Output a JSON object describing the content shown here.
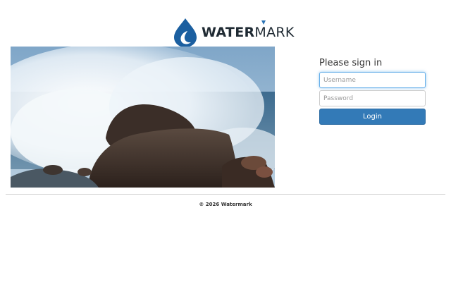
{
  "brand": {
    "name_bold": "WATER",
    "name_light": "MARK",
    "logo_icon": "water-drop-icon",
    "accent": "#2b73b5"
  },
  "hero": {
    "icon": "ocean-wave-rocks-photo"
  },
  "signin": {
    "title": "Please sign in",
    "username_placeholder": "Username",
    "password_placeholder": "Password",
    "login_label": "Login",
    "button_color": "#337ab7"
  },
  "footer": {
    "copyright": "© 2026 Watermark"
  }
}
